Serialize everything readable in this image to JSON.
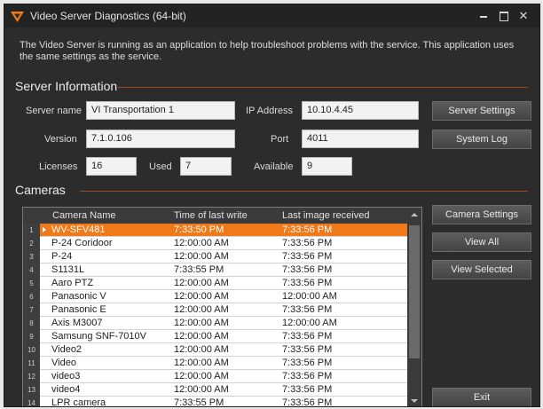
{
  "window": {
    "title": "Video Server Diagnostics (64-bit)",
    "accent_color": "#f07a1a",
    "icons": {
      "app": "video-server-logo-icon",
      "minimize": "minimize-icon",
      "maximize": "maximize-icon",
      "close": "close-icon"
    }
  },
  "intro": {
    "text": "The Video Server is running as an application to help troubleshoot problems with the service.  This application uses the same settings as the service."
  },
  "server_info": {
    "section_title": "Server Information",
    "server_name_label": "Server name",
    "server_name_value": "VI Transportation 1",
    "ip_label": "IP Address",
    "ip_value": "10.10.4.45",
    "version_label": "Version",
    "version_value": "7.1.0.106",
    "port_label": "Port",
    "port_value": "4011",
    "licenses_label": "Licenses",
    "licenses_value": "16",
    "used_label": "Used",
    "used_value": "7",
    "available_label": "Available",
    "available_value": "9",
    "server_settings_button": "Server Settings",
    "system_log_button": "System Log"
  },
  "cameras": {
    "section_title": "Cameras",
    "columns": [
      "Camera Name",
      "Time of last write",
      "Last image received"
    ],
    "selected_row": 1,
    "rows": [
      {
        "num": "1",
        "name": "WV-SFV481",
        "last_write": "7:33:50 PM",
        "last_image": "7:33:56 PM"
      },
      {
        "num": "2",
        "name": "P-24 Coridoor",
        "last_write": "12:00:00 AM",
        "last_image": "7:33:56 PM"
      },
      {
        "num": "3",
        "name": "P-24",
        "last_write": "12:00:00 AM",
        "last_image": "7:33:56 PM"
      },
      {
        "num": "4",
        "name": "S1131L",
        "last_write": "7:33:55 PM",
        "last_image": "7:33:56 PM"
      },
      {
        "num": "5",
        "name": "Aaro PTZ",
        "last_write": "12:00:00 AM",
        "last_image": "7:33:56 PM"
      },
      {
        "num": "6",
        "name": "Panasonic V",
        "last_write": "12:00:00 AM",
        "last_image": "12:00:00 AM"
      },
      {
        "num": "7",
        "name": "Panasonic E",
        "last_write": "12:00:00 AM",
        "last_image": "7:33:56 PM"
      },
      {
        "num": "8",
        "name": "Axis M3007",
        "last_write": "12:00:00 AM",
        "last_image": "12:00:00 AM"
      },
      {
        "num": "9",
        "name": "Samsung SNF-7010V",
        "last_write": "12:00:00 AM",
        "last_image": "7:33:56 PM"
      },
      {
        "num": "10",
        "name": "Video2",
        "last_write": "12:00:00 AM",
        "last_image": "7:33:56 PM"
      },
      {
        "num": "11",
        "name": "Video",
        "last_write": "12:00:00 AM",
        "last_image": "7:33:56 PM"
      },
      {
        "num": "12",
        "name": "video3",
        "last_write": "12:00:00 AM",
        "last_image": "7:33:56 PM"
      },
      {
        "num": "13",
        "name": "video4",
        "last_write": "12:00:00 AM",
        "last_image": "7:33:56 PM"
      },
      {
        "num": "14",
        "name": "LPR camera",
        "last_write": "7:33:55 PM",
        "last_image": "7:33:56 PM"
      }
    ],
    "camera_settings_button": "Camera Settings",
    "view_all_button": "View All",
    "view_selected_button": "View Selected",
    "exit_button": "Exit"
  }
}
